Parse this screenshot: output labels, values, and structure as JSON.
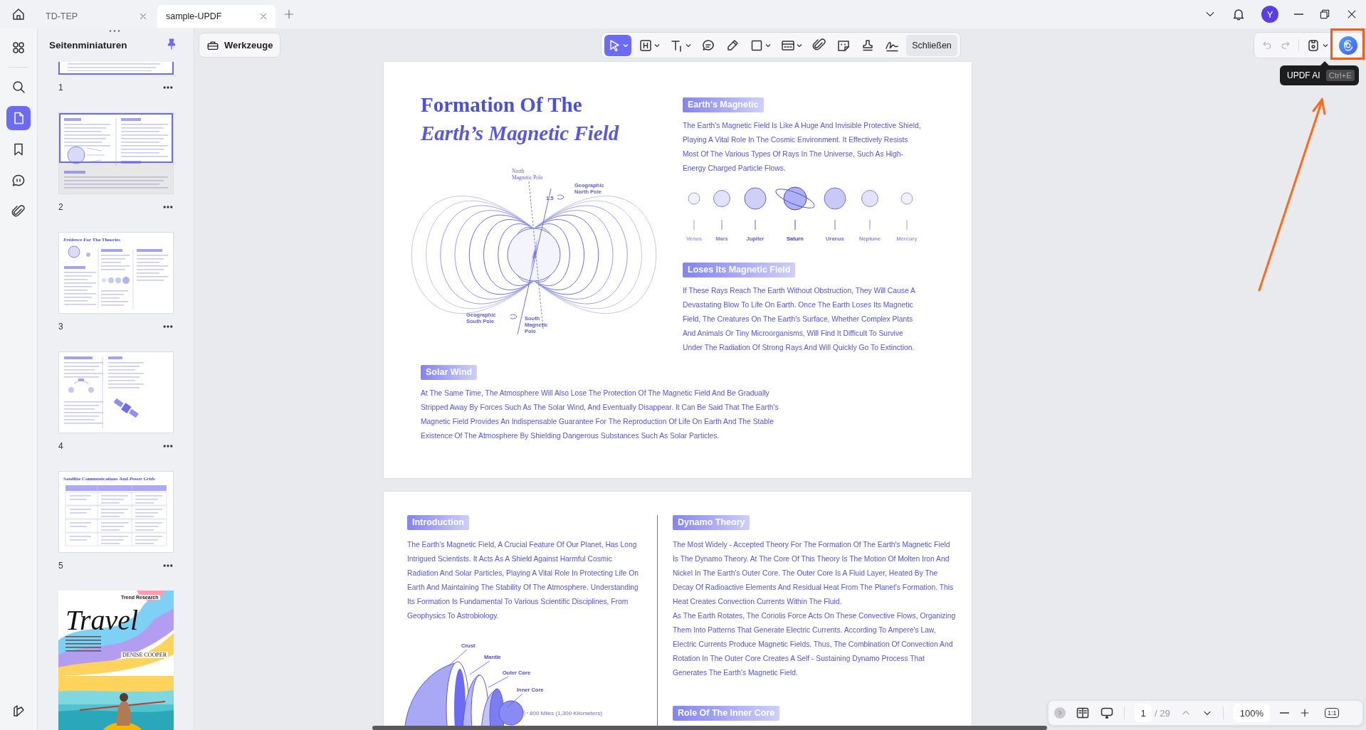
{
  "tabs": [
    {
      "label": "TD-TEP",
      "selected": false
    },
    {
      "label": "sample-UPDF",
      "selected": true
    }
  ],
  "account": {
    "initial": "Y"
  },
  "rail": [
    {
      "selected": false
    },
    {
      "selected": false
    },
    {
      "selected": true
    },
    {
      "selected": false
    },
    {
      "selected": false
    },
    {
      "selected": false
    }
  ],
  "thumbnail_panel": {
    "title": "Seitenminiaturen",
    "pages": [
      {
        "number": "1",
        "kind": "text",
        "in_view": true
      },
      {
        "number": "2",
        "kind": "split",
        "in_view": true
      },
      {
        "number": "3",
        "kind": "theories",
        "title": "*Evidence* For The Theories"
      },
      {
        "number": "4",
        "kind": "satellite"
      },
      {
        "number": "5",
        "kind": "table",
        "title": "Satellite Communications And *Power Grids*"
      },
      {
        "kind": "cover",
        "title": "Travel",
        "subtitle": "Trend Research",
        "author": "DENISE COOPER"
      }
    ]
  },
  "toolbar": {
    "tools_button": "Werkzeuge",
    "tools": [
      {
        "selected": true,
        "menu": true
      },
      {
        "selected": false,
        "menu": true
      },
      {
        "selected": false,
        "menu": true
      },
      {
        "selected": false,
        "menu": false
      },
      {
        "selected": false,
        "menu": false
      },
      {
        "selected": false,
        "menu": true
      },
      {
        "selected": false,
        "menu": true
      },
      {
        "selected": false,
        "menu": false
      },
      {
        "selected": false,
        "menu": false
      },
      {
        "selected": false,
        "menu": false
      },
      {
        "selected": false,
        "menu": false
      }
    ],
    "close_button": "Schließen",
    "undo": {
      "disabled": true
    },
    "redo": {
      "disabled": true
    },
    "tooltip": {
      "label": "UPDF AI",
      "shortcut": "Ctrl+E"
    }
  },
  "document": {
    "page_1": {
      "title": "Formation Of The",
      "subtitle": "Earth’s Magnetic Field",
      "diagram_labels": [
        "North\nMagnetic Pole",
        "Geographic\nNorth Pole",
        "1.5",
        "Geographic\nSouth Pole",
        "South\nMagnetic\nPole"
      ],
      "planets": [
        "Venus",
        "Mars",
        "Jupiter",
        "Saturn",
        "Uranus",
        "Neptune",
        "Mercury"
      ],
      "sections": [
        {
          "heading": "Earth's Magnetic",
          "text": "The Earth's Magnetic Field Is Like A Huge And Invisible Protective Shield, Playing A Vital Role In The Cosmic Environment. It Effectively Resists Most Of The Various Types Of Rays In The Universe, Such As High-Energy Charged Particle Flows."
        },
        {
          "heading": "Loses Its Magnetic Field",
          "text": "If These Rays Reach The Earth Without Obstruction, They Will Cause A Devastating Blow To Life On Earth. Once The Earth Loses Its Magnetic Field, The Creatures On The Earth's Surface, Whether Complex Plants And Animals Or Tiny Microorganisms, Will Find It Difficult To Survive Under The Radiation Of Strong Rays And Will Quickly Go To Extinction."
        },
        {
          "heading": "Solar Wind",
          "text": "At The Same Time, The Atmosphere Will Also Lose The Protection Of The Magnetic Field And Be Gradually Stripped Away By Forces Such As The Solar Wind, And Eventually Disappear. It Can Be Said That The Earth's Magnetic Field Provides An Indispensable Guarantee For The Reproduction Of Life On Earth And The Stable Existence Of The Atmosphere By Shielding Dangerous Substances Such As Solar Particles."
        }
      ]
    },
    "page_2": {
      "sections": [
        {
          "heading": "Introduction",
          "paragraphs": [
            "The Earth's Magnetic Field, A Crucial Feature Of Our Planet, Has Long Intrigued Scientists. It Acts As A Shield Against Harmful Cosmic Radiation And Solar Particles, Playing A Vital Role In Protecting Life On Earth And Maintaining The Stability Of The Atmosphere. Understanding Its Formation Is Fundamental To Various Scientific Disciplines, From Geophysics To Astrobiology."
          ]
        },
        {
          "heading": "Dynamo Theory",
          "paragraphs": [
            "The Most Widely - Accepted Theory For The Formation Of The Earth's Magnetic Field Is The Dynamo Theory. At The Core Of This Theory Is The Motion Of Molten Iron And Nickel In The Earth's Outer Core. The Outer Core Is A Fluid Layer, Heated By The Decay Of Radioactive Elements And Residual Heat From The Planet's Formation. This Heat Creates Convection Currents Within The Fluid.",
            "As The Earth Rotates, The Coriolis Force Acts On These Convective Flows, Organizing Them Into Patterns That Generate Electric Currents. According To Ampere's Law, Electric Currents Produce Magnetic Fields. Thus, The Combination Of Convection And Rotation In The Outer Core Creates A Self - Sustaining Dynamo Process That Generates The Earth's Magnetic Field."
          ]
        },
        {
          "heading": "Role Of The Inner Core"
        }
      ],
      "layer_labels": [
        "Crust",
        "Mantle",
        "Outer Core",
        "Inner Core",
        "800 Miles (1,300 Kilometers)"
      ]
    }
  },
  "status_bar": {
    "page": "1",
    "total": "/ 29",
    "zoom": "100%",
    "actual_size": "1:1"
  }
}
